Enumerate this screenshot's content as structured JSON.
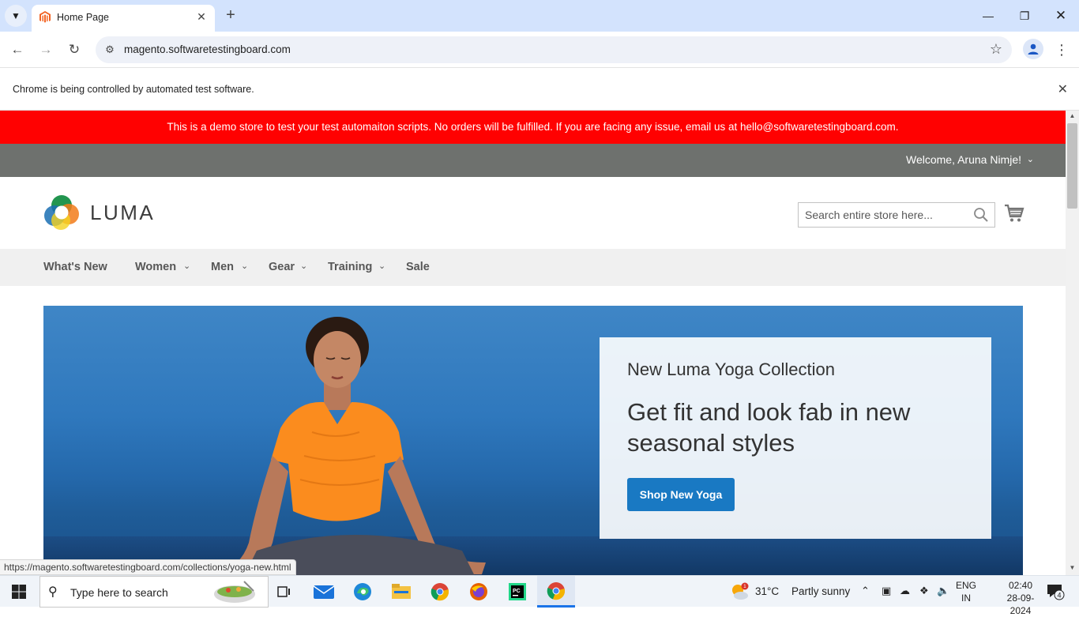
{
  "browser": {
    "tab_title": "Home Page",
    "url": "magento.softwaretestingboard.com",
    "infobar_text": "Chrome is being controlled by automated test software.",
    "status_url": "https://magento.softwaretestingboard.com/collections/yoga-new.html"
  },
  "page": {
    "demo_banner": "This is a demo store to test your test automaiton scripts. No orders will be fulfilled. If you are facing any issue, email us at hello@softwaretestingboard.com.",
    "welcome": "Welcome, Aruna Nimje!",
    "logo_text": "LUMA",
    "search_placeholder": "Search entire store here...",
    "nav": [
      {
        "label": "What's New"
      },
      {
        "label": "Women"
      },
      {
        "label": "Men"
      },
      {
        "label": "Gear"
      },
      {
        "label": "Training"
      },
      {
        "label": "Sale"
      }
    ],
    "hero": {
      "kicker": "New Luma Yoga Collection",
      "headline": "Get fit and look fab in new seasonal styles",
      "cta": "Shop New Yoga"
    }
  },
  "taskbar": {
    "search_text": "Type here to search",
    "weather_temp": "31°C",
    "weather_desc": "Partly sunny",
    "weather_badge": "1",
    "lang_line1": "ENG",
    "lang_line2": "IN",
    "time": "02:40",
    "date": "28-09-2024",
    "notification_count": "4"
  },
  "colors": {
    "demo_banner": "#ff0101",
    "panel_header": "#6e716e",
    "primary_button": "#1979c3"
  }
}
